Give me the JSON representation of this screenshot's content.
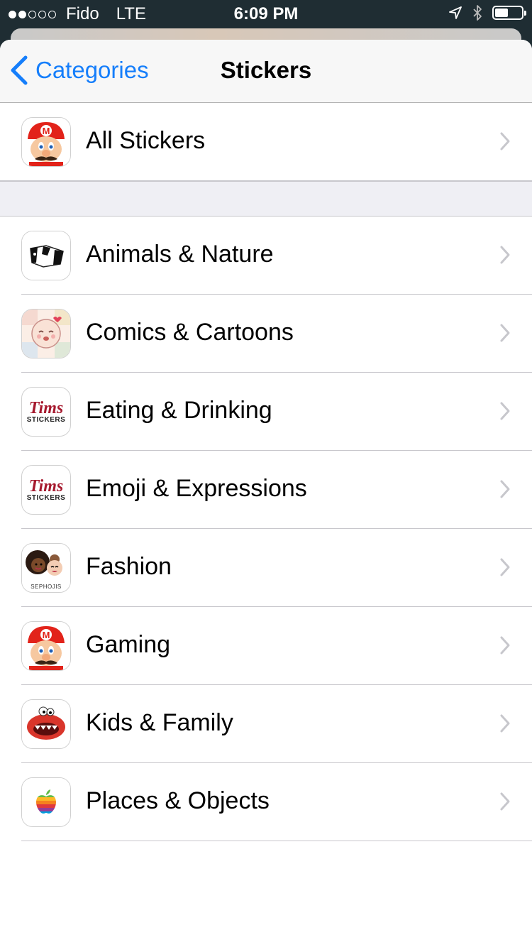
{
  "status_bar": {
    "carrier": "Fido",
    "network": "LTE",
    "time": "6:09 PM",
    "signal_bars_filled": 2,
    "signal_bars_total": 5,
    "battery_level": 0.5
  },
  "nav": {
    "back_label": "Categories",
    "title": "Stickers",
    "accent_color": "#157efb"
  },
  "top_item": {
    "label": "All Stickers",
    "icon": "mario-icon"
  },
  "categories": [
    {
      "label": "Animals & Nature",
      "icon": "panda-icon"
    },
    {
      "label": "Comics & Cartoons",
      "icon": "cartoon-face-icon"
    },
    {
      "label": "Eating & Drinking",
      "icon": "tims-stickers-icon",
      "icon_text": "Tims",
      "icon_subtext": "STICKERS"
    },
    {
      "label": "Emoji & Expressions",
      "icon": "tims-stickers-icon",
      "icon_text": "Tims",
      "icon_subtext": "STICKERS"
    },
    {
      "label": "Fashion",
      "icon": "sephojis-icon",
      "icon_text": "SEPHOJIS"
    },
    {
      "label": "Gaming",
      "icon": "mario-icon"
    },
    {
      "label": "Kids & Family",
      "icon": "red-monster-icon"
    },
    {
      "label": "Places & Objects",
      "icon": "apple-logo-icon"
    }
  ]
}
